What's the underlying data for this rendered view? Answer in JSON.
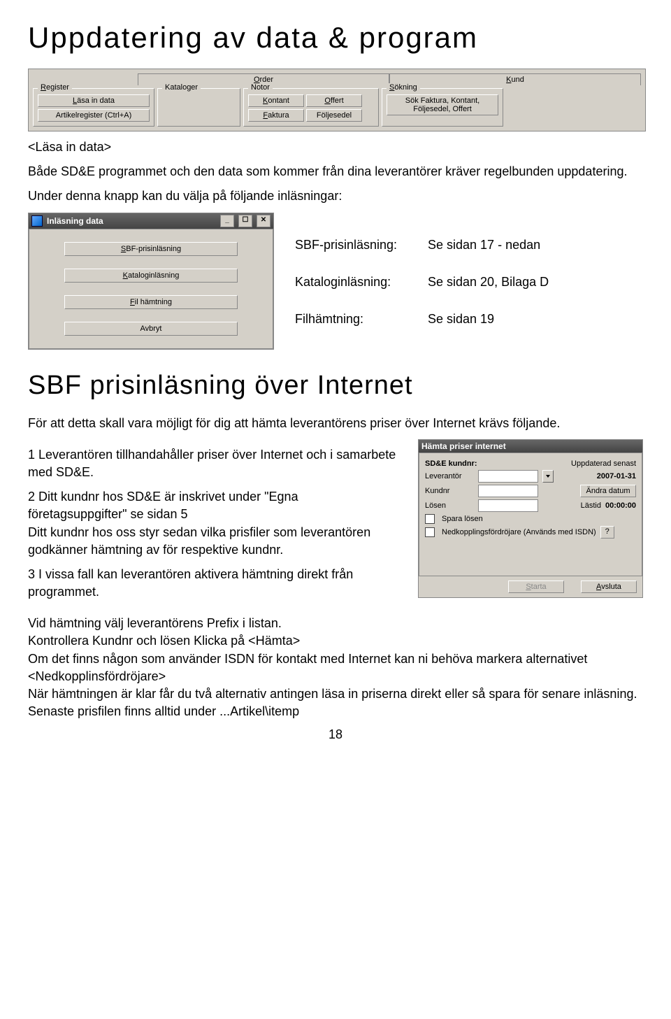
{
  "title": "Uppdatering av data & program",
  "gui1": {
    "tabs": [
      "Order",
      "Kund"
    ],
    "groups": {
      "register": {
        "label": "Register",
        "btns": [
          "Läsa in data",
          "Artikelregister (Ctrl+A)"
        ]
      },
      "kataloger": {
        "label": "Kataloger"
      },
      "notor": {
        "label": "Notor",
        "btns": [
          "Kontant",
          "Offert",
          "Faktura",
          "Följesedel"
        ]
      },
      "sokning": {
        "label": "Sökning",
        "btns": [
          "Sök Faktura, Kontant, Följesedel, Offert"
        ]
      }
    }
  },
  "para1": "<Läsa in data>",
  "para2": "Både SD&E programmet och den data som kommer från dina leverantörer kräver regelbunden uppdatering.",
  "para3": "Under denna knapp kan du välja på följande inläsningar:",
  "gui2": {
    "title": "Inläsning data",
    "btns": [
      "SBF-prisinläsning",
      "Kataloginläsning",
      "Fil hämtning",
      "Avbryt"
    ]
  },
  "list_right": [
    {
      "k": "SBF-prisinläsning:",
      "v": "Se sidan 17 - nedan"
    },
    {
      "k": "Kataloginläsning:",
      "v": "Se sidan 20, Bilaga D"
    },
    {
      "k": "Filhämtning:",
      "v": "Se sidan 19"
    }
  ],
  "subtitle": "SBF prisinläsning över Internet",
  "intro2": "För att detta skall vara möjligt för dig att hämta leverantörens priser över Internet krävs följande.",
  "item1": "1 Leverantören tillhandahåller priser över Internet och i samarbete med SD&E.",
  "item2a": "2 Ditt kundnr hos SD&E är inskrivet under \"Egna företagsuppgifter\" se sidan 5",
  "item2b": "Ditt kundnr hos oss styr sedan vilka prisfiler som leverantören godkänner hämtning av för respektive kundnr.",
  "item3": "3 I vissa fall kan leverantören aktivera hämtning direkt från programmet.",
  "para4": "Vid hämtning välj leverantörens Prefix i listan.",
  "para5": "Kontrollera Kundnr och lösen Klicka på <Hämta>",
  "para6": "Om det finns någon som använder ISDN för kontakt med Internet kan ni behöva markera alternativet <Nedkopplinsfördröjare>",
  "para7": "När hämtningen är klar får du två alternativ antingen läsa in priserna direkt eller så spara för senare inläsning. Senaste prisfilen finns alltid under ...Artikel\\itemp",
  "gui3": {
    "title": "Hämta priser internet",
    "kundnr_label": "SD&E kundnr:",
    "upd_label": "Uppdaterad senast",
    "upd_value": "2007-01-31",
    "leverantor": "Leverantör",
    "kundnr": "Kundnr",
    "losen": "Lösen",
    "andra": "Ändra datum",
    "lastid_lbl": "Lästid",
    "lastid_val": "00:00:00",
    "spara": "Spara lösen",
    "nedkoppl": "Nedkopplingsfördröjare (Används med ISDN)",
    "starta": "Starta",
    "avsluta": "Avsluta"
  },
  "pagenum": "18"
}
